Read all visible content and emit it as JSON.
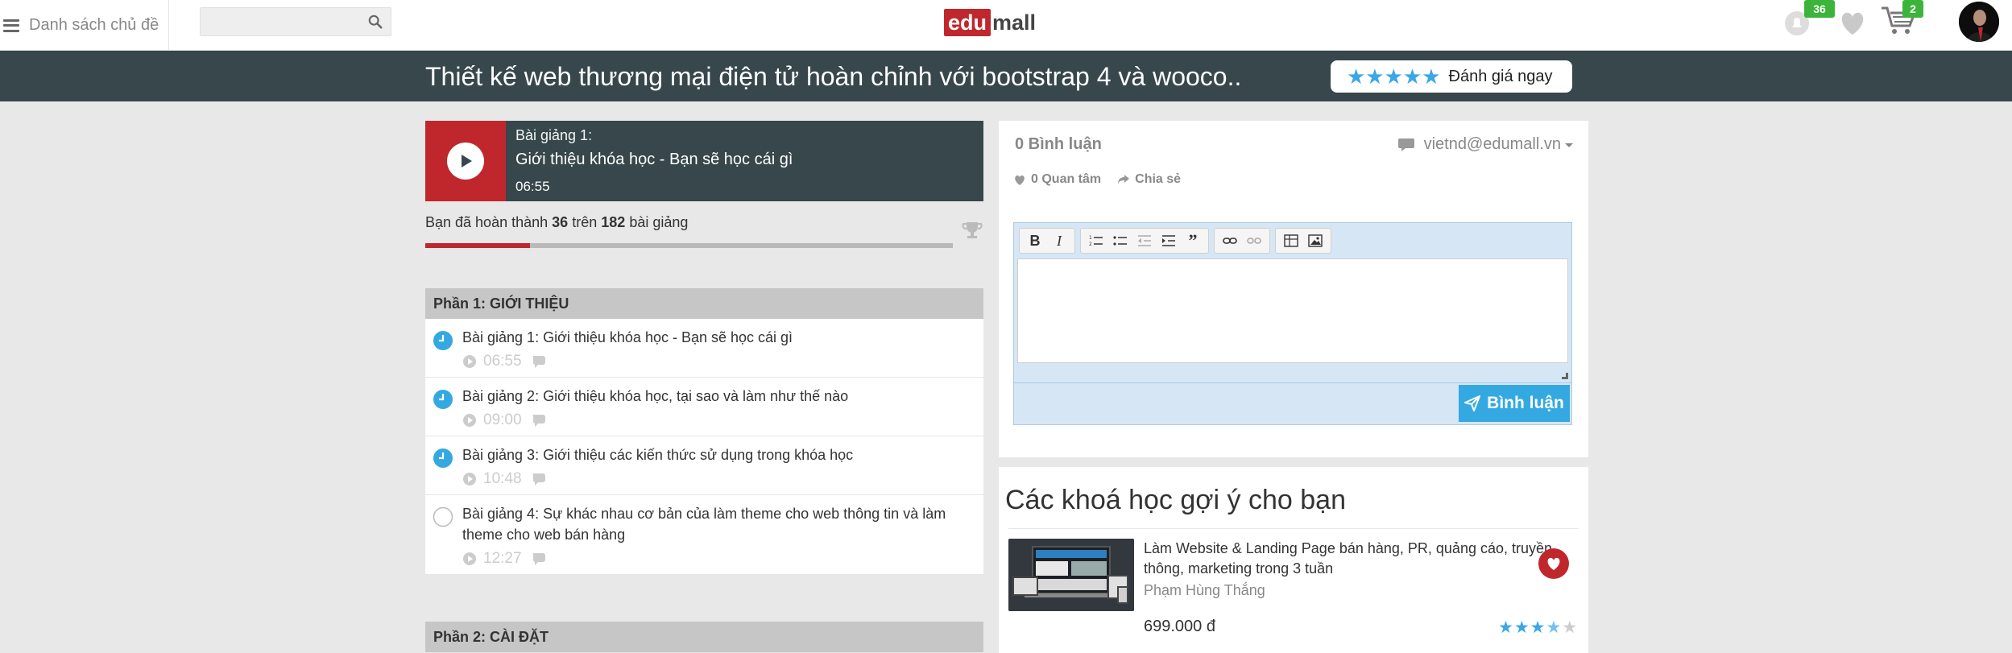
{
  "topbar": {
    "menu_label": "Danh sách chủ đề",
    "search": {
      "value": "",
      "placeholder": ""
    },
    "logo": {
      "edu": "edu",
      "mall": "mall"
    },
    "notifications_count": "36",
    "cart_count": "2"
  },
  "course": {
    "title": "Thiết kế web thương mại điện tử hoàn chỉnh với bootstrap 4 và wooco..",
    "rate_label": "Đánh giá ngay",
    "rate_stars": "★★★★★"
  },
  "now_playing": {
    "lesson_label": "Bài giảng 1:",
    "title": "Giới thiệu khóa học - Bạn sẽ học cái gì",
    "duration": "06:55"
  },
  "progress": {
    "prefix": "Bạn đã hoàn thành",
    "completed": "36",
    "middle": "trên",
    "total": "182",
    "suffix": "bài giảng",
    "fraction": 0.198
  },
  "curriculum": {
    "sections": [
      {
        "title": "Phần 1: GIỚI THIỆU",
        "lessons": [
          {
            "title": "Bài giảng 1: Giới thiệu khóa học - Bạn sẽ học cái gì",
            "duration": "06:55",
            "done": true
          },
          {
            "title": "Bài giảng 2: Giới thiệu khóa học, tại sao và làm như thế nào",
            "duration": "09:00",
            "done": true
          },
          {
            "title": "Bài giảng 3: Giới thiệu các kiến thức sử dụng trong khóa học",
            "duration": "10:48",
            "done": true
          },
          {
            "title": "Bài giảng 4: Sự khác nhau cơ bản của làm theme cho web thông tin và làm theme cho web bán hàng",
            "duration": "12:27",
            "done": false
          }
        ]
      },
      {
        "title": "Phần 2: CÀI ĐẶT"
      }
    ]
  },
  "comments": {
    "count_label": "0 Bình luận",
    "user": "vietnd@edumall.vn",
    "likes_label": "0 Quan tâm",
    "share_label": "Chia sẻ",
    "editor_value": "",
    "submit_label": "Bình luận"
  },
  "suggestions": {
    "title": "Các khoá học gợi ý cho bạn",
    "items": [
      {
        "title": "Làm Website & Landing Page bán hàng, PR, quảng cáo, truyền thông, marketing trong 3 tuần",
        "author": "Phạm Hùng Thắng",
        "price": "699.000 đ",
        "rating": 3.5
      }
    ]
  },
  "colors": {
    "accent_red": "#c0272d",
    "header_dark": "#37474c",
    "link_blue": "#34a9e1",
    "badge_green": "#3cb43c"
  }
}
